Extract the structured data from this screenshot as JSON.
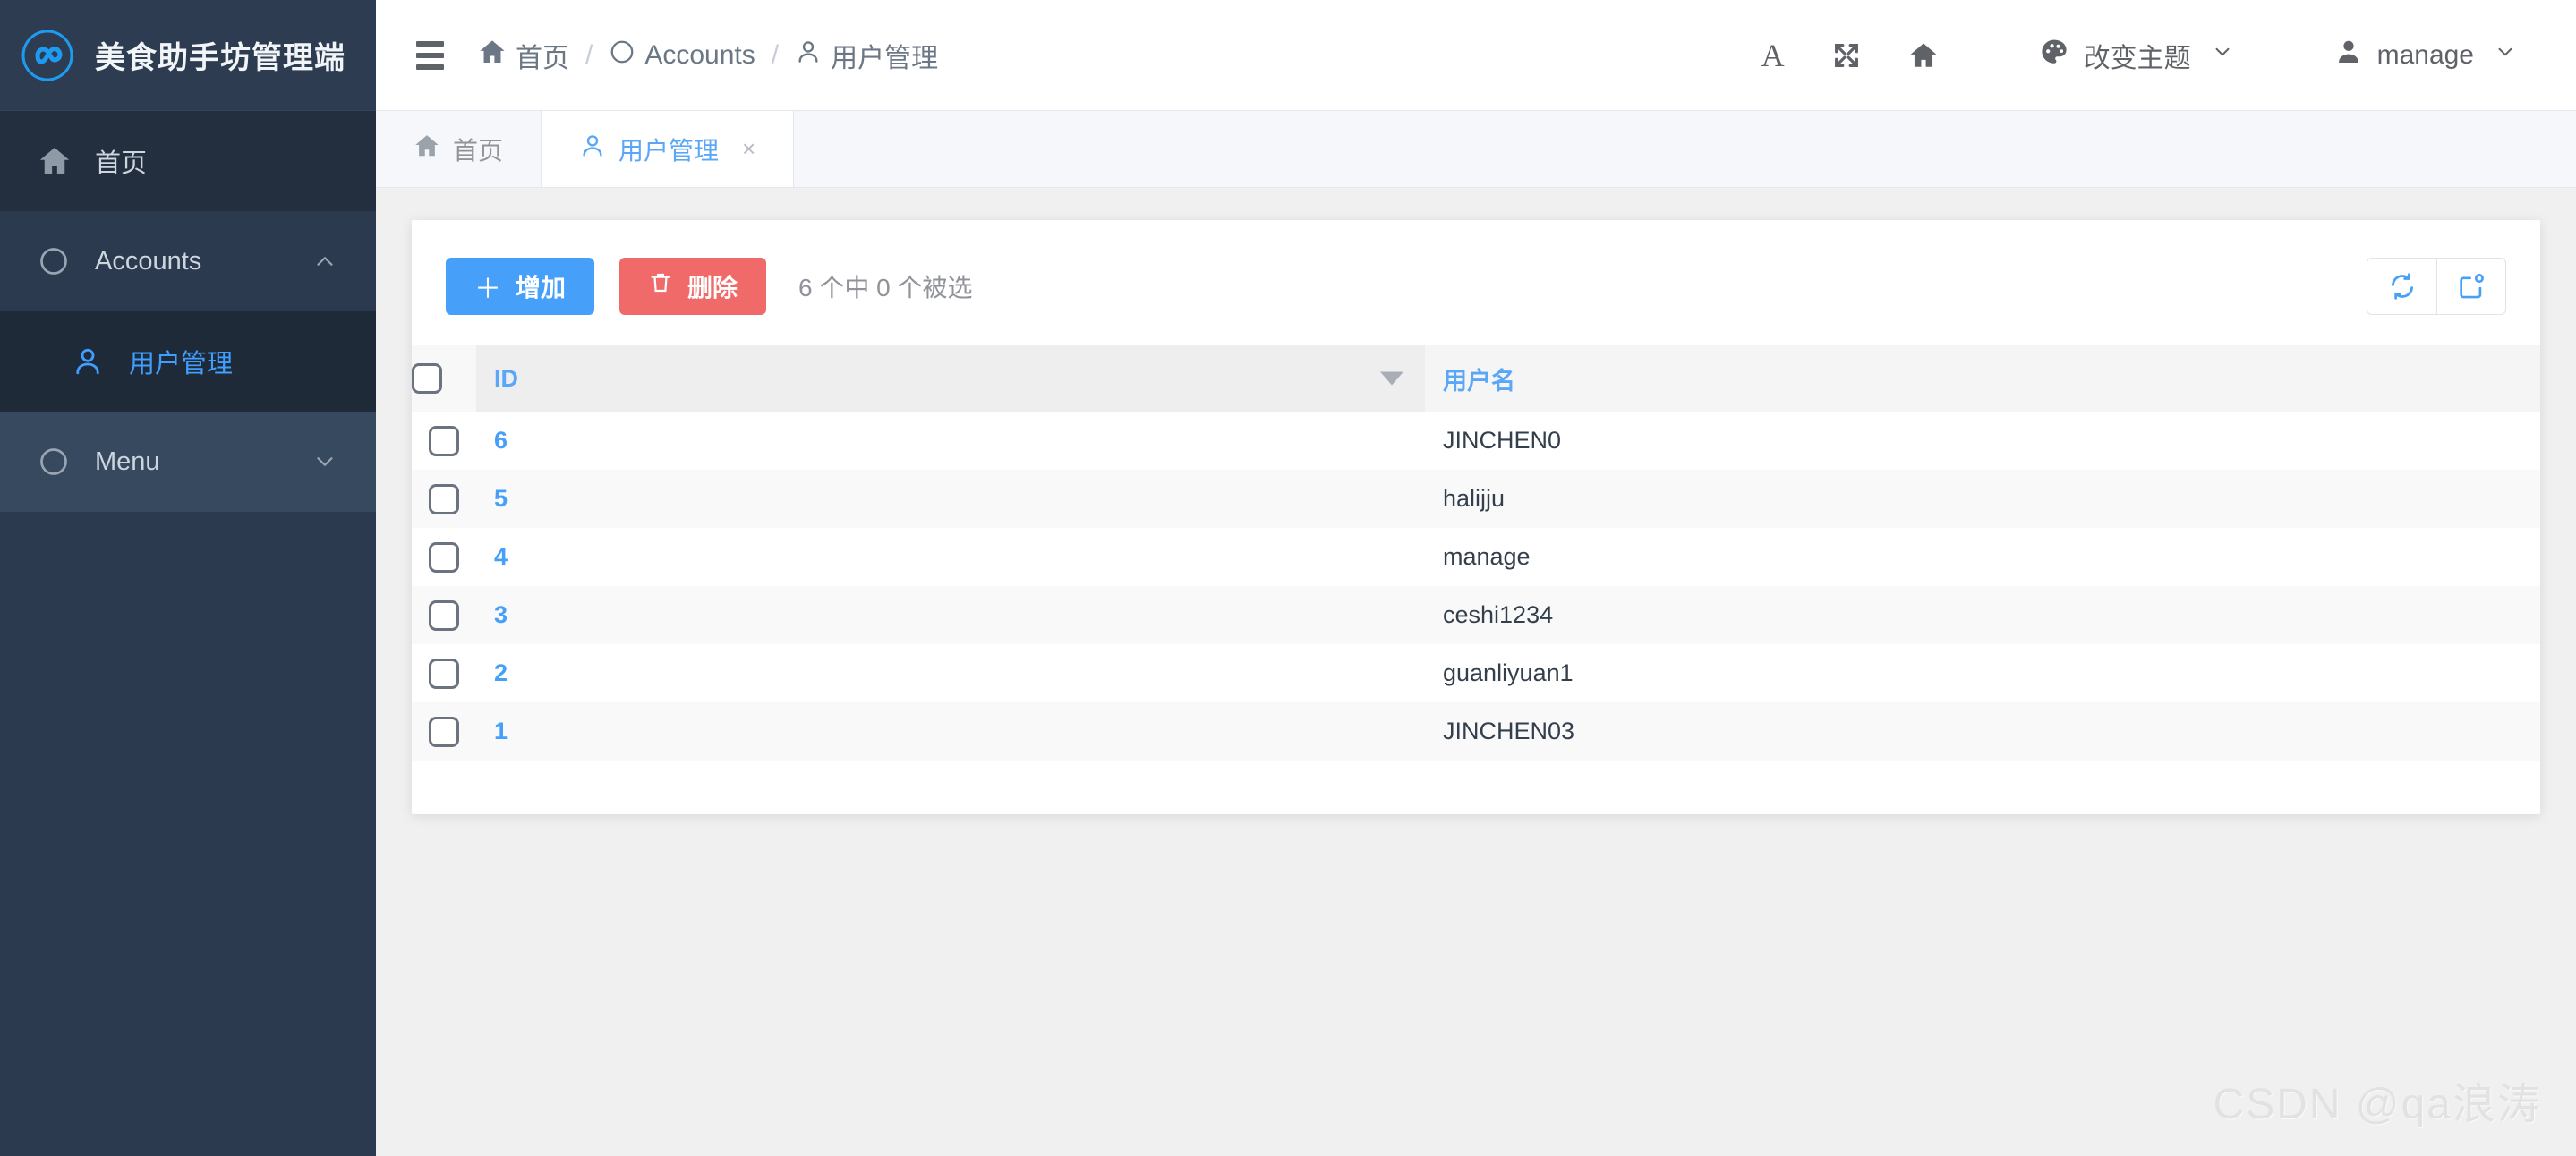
{
  "brand": {
    "title": "美食助手坊管理端",
    "logo_icon": "infinity-circle-icon",
    "logo_color": "#1e9bf0"
  },
  "sidebar": {
    "items": [
      {
        "label": "首页",
        "icon": "home-icon",
        "arrow": "",
        "state": "normal"
      },
      {
        "label": "Accounts",
        "icon": "circle-icon",
        "arrow": "⌃",
        "state": "expanded"
      },
      {
        "label": "用户管理",
        "icon": "user-icon",
        "arrow": "",
        "state": "active-child"
      },
      {
        "label": "Menu",
        "icon": "circle-icon",
        "arrow": "⌄",
        "state": "collapsed"
      }
    ]
  },
  "header": {
    "menu_toggle": "hamburger-icon",
    "breadcrumb": [
      {
        "label": "首页",
        "icon": "home-icon"
      },
      {
        "label": "Accounts",
        "icon": "circle-icon"
      },
      {
        "label": "用户管理",
        "icon": "user-icon"
      }
    ],
    "separator": "/",
    "actions": {
      "font_size_label": "A",
      "fullscreen_icon": "fullscreen-arrows-icon",
      "home_icon": "home-icon",
      "theme_label": "改变主题",
      "theme_icon": "palette-icon",
      "theme_chevron": "⌄",
      "user_label": "manage",
      "user_icon": "user-avatar-icon",
      "user_chevron": "⌄"
    }
  },
  "tabs": [
    {
      "label": "首页",
      "icon": "home-icon",
      "active": false,
      "closable": false
    },
    {
      "label": "用户管理",
      "icon": "user-icon",
      "active": true,
      "closable": true,
      "close": "×"
    }
  ],
  "toolbar": {
    "add_label": "增加",
    "add_icon": "plus-icon",
    "delete_label": "删除",
    "delete_icon": "trash-icon",
    "selection_text": "6 个中 0 个被选",
    "refresh_icon": "refresh-icon",
    "columns_icon": "columns-settings-icon"
  },
  "table": {
    "columns": [
      {
        "key": "check",
        "label": ""
      },
      {
        "key": "id",
        "label": "ID",
        "sortable": true,
        "sort_icon": "caret-down-icon"
      },
      {
        "key": "name",
        "label": "用户名"
      }
    ],
    "rows": [
      {
        "id": "6",
        "name": "JINCHEN0"
      },
      {
        "id": "5",
        "name": "halijju"
      },
      {
        "id": "4",
        "name": "manage"
      },
      {
        "id": "3",
        "name": "ceshi1234"
      },
      {
        "id": "2",
        "name": "guanliyuan1"
      },
      {
        "id": "1",
        "name": "JINCHEN03"
      }
    ]
  },
  "watermark": "CSDN @qa浪涛",
  "colors": {
    "sidebar_bg": "#2b3a4f",
    "sidebar_active": "#1f2a38",
    "accent_blue": "#46a0fa",
    "link_blue": "#5ba7f7",
    "danger_red": "#f16a6a",
    "page_bg": "#f0f0f0"
  }
}
